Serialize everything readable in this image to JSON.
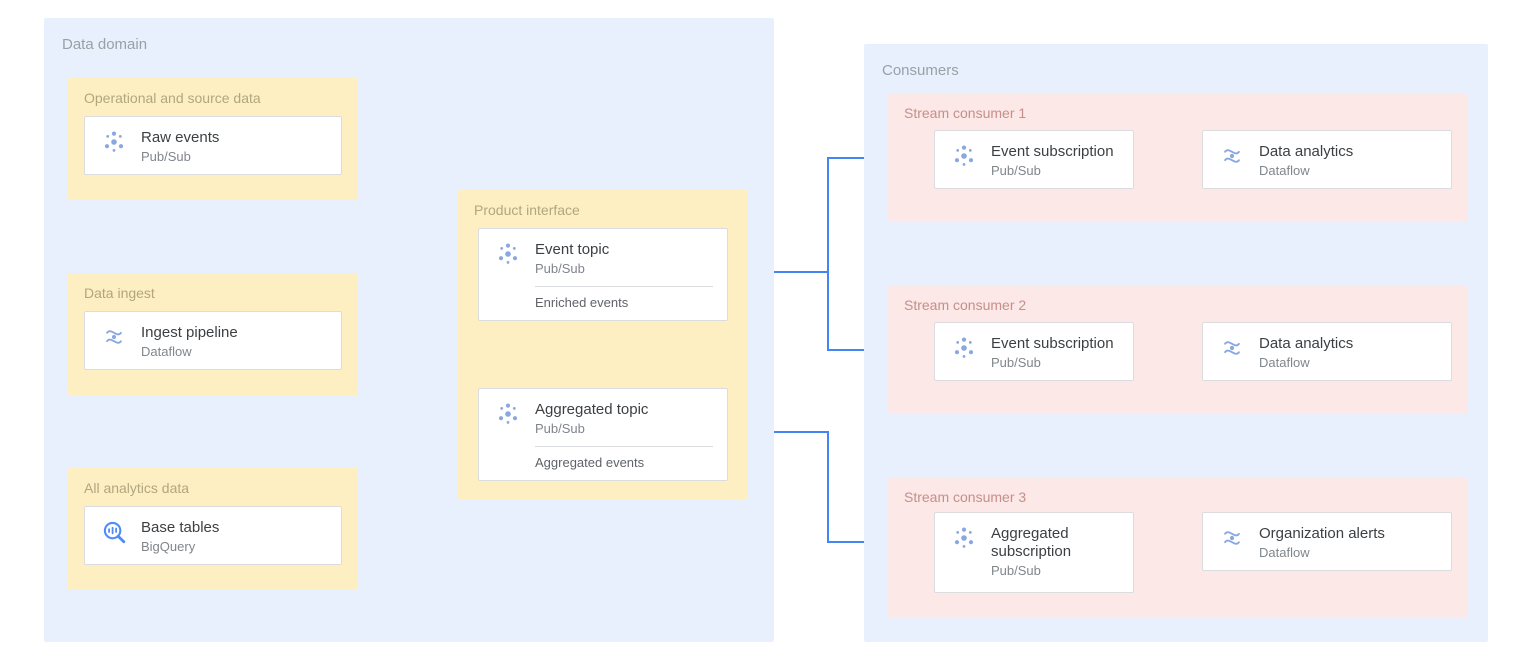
{
  "regions": {
    "dataDomain": {
      "title": "Data domain"
    },
    "consumers": {
      "title": "Consumers"
    }
  },
  "groups": {
    "opSource": {
      "title": "Operational and source data"
    },
    "dataIngest": {
      "title": "Data ingest"
    },
    "allData": {
      "title": "All analytics data"
    },
    "productIf": {
      "title": "Product interface"
    },
    "sc1": {
      "title": "Stream consumer 1"
    },
    "sc2": {
      "title": "Stream consumer 2"
    },
    "sc3": {
      "title": "Stream consumer 3"
    }
  },
  "nodes": {
    "rawEvents": {
      "title": "Raw events",
      "subtitle": "Pub/Sub"
    },
    "ingest": {
      "title": "Ingest pipeline",
      "subtitle": "Dataflow"
    },
    "baseTables": {
      "title": "Base tables",
      "subtitle": "BigQuery"
    },
    "eventTopic": {
      "title": "Event topic",
      "subtitle": "Pub/Sub",
      "detail": "Enriched events"
    },
    "aggTopic": {
      "title": "Aggregated topic",
      "subtitle": "Pub/Sub",
      "detail": "Aggregated events"
    },
    "sc1sub": {
      "title": "Event subscription",
      "subtitle": "Pub/Sub"
    },
    "sc1an": {
      "title": "Data analytics",
      "subtitle": "Dataflow"
    },
    "sc2sub": {
      "title": "Event subscription",
      "subtitle": "Pub/Sub"
    },
    "sc2an": {
      "title": "Data analytics",
      "subtitle": "Dataflow"
    },
    "sc3sub": {
      "title": "Aggregated subscription",
      "subtitle": "Pub/Sub"
    },
    "sc3an": {
      "title": "Organization alerts",
      "subtitle": "Dataflow"
    }
  },
  "colors": {
    "arrow": "#4285f4",
    "regionBg": "#e8f0fe",
    "yellowBg": "#feefc3",
    "pinkBg": "#fce8e6"
  }
}
